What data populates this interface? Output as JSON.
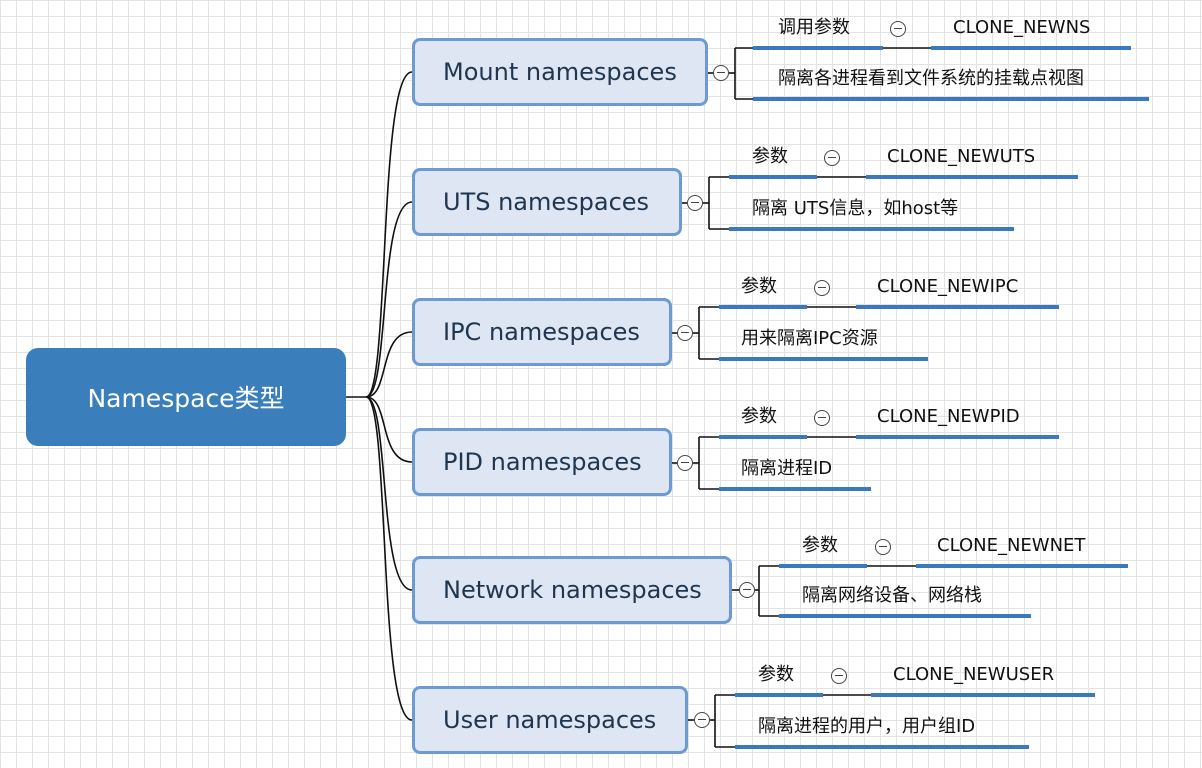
{
  "root": {
    "label": "Namespace类型"
  },
  "branches": [
    {
      "label": "Mount namespaces",
      "param_label": "调用参数",
      "flag": "CLONE_NEWNS",
      "desc": "隔离各进程看到文件系统的挂载点视图"
    },
    {
      "label": "UTS namespaces",
      "param_label": "参数",
      "flag": "CLONE_NEWUTS",
      "desc": "隔离 UTS信息，如host等"
    },
    {
      "label": "IPC namespaces",
      "param_label": "参数",
      "flag": "CLONE_NEWIPC",
      "desc": "用来隔离IPC资源"
    },
    {
      "label": "PID namespaces",
      "param_label": "参数",
      "flag": "CLONE_NEWPID",
      "desc": "隔离进程ID"
    },
    {
      "label": "Network namespaces",
      "param_label": "参数",
      "flag": "CLONE_NEWNET",
      "desc": "隔离网络设备、网络栈"
    },
    {
      "label": "User namespaces",
      "param_label": "参数",
      "flag": "CLONE_NEWUSER",
      "desc": "隔离进程的用户，用户组ID"
    }
  ],
  "colors": {
    "root_fill": "#3a7fbc",
    "node_fill": "#dde6f2",
    "node_border": "#6d9ad3",
    "leaf_underline": "#3b79bf",
    "connector": "#111111"
  },
  "icons": {
    "collapse": "collapse-minus-icon"
  }
}
